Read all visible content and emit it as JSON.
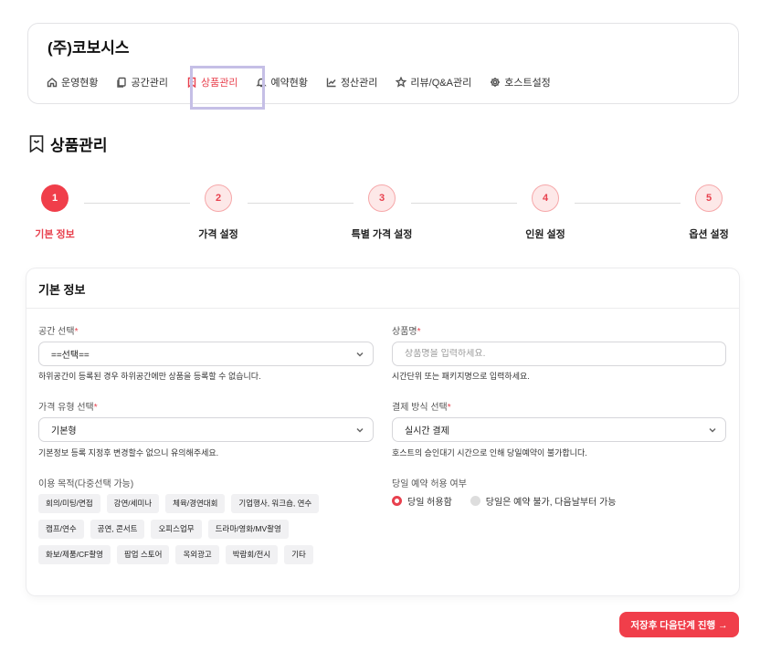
{
  "app": {
    "brand": "(주)코보시스"
  },
  "nav": {
    "items": [
      {
        "label": "운영현황",
        "icon": "home-icon"
      },
      {
        "label": "공간관리",
        "icon": "copy-icon"
      },
      {
        "label": "상품관리",
        "icon": "bookmark-icon",
        "active": true
      },
      {
        "label": "예약현황",
        "icon": "bell-icon"
      },
      {
        "label": "정산관리",
        "icon": "chart-icon"
      },
      {
        "label": "리뷰/Q&A관리",
        "icon": "star-icon"
      },
      {
        "label": "호스트설정",
        "icon": "gear-icon"
      }
    ]
  },
  "page": {
    "title": "상품관리",
    "icon": "bookmark-icon"
  },
  "stepper": {
    "steps": [
      {
        "num": "1",
        "label": "기본 정보",
        "active": true
      },
      {
        "num": "2",
        "label": "가격 설정"
      },
      {
        "num": "3",
        "label": "특별 가격 설정"
      },
      {
        "num": "4",
        "label": "인원 설정"
      },
      {
        "num": "5",
        "label": "옵션 설정"
      }
    ]
  },
  "form": {
    "title": "기본 정보",
    "space": {
      "label": "공간 선택",
      "value": "==선택==",
      "hint": "하위공간이 등록된 경우 하위공간에만 상품을 등록할 수 없습니다."
    },
    "product_name": {
      "label": "상품명",
      "placeholder": "상품명을 입력하세요.",
      "hint": "시간단위 또는 패키지명으로 입력하세요."
    },
    "price_type": {
      "label": "가격 유형 선택",
      "value": "기본형",
      "hint": "기본정보 등록 지정후 변경할수 없으니 유의해주세요."
    },
    "payment": {
      "label": "결제 방식 선택",
      "value": "실시간 결제",
      "hint": "호스트의 승인대기 시간으로 인해 당일예약이 불가합니다."
    },
    "purpose": {
      "label": "이용 목적(다중선택 가능)",
      "rows": [
        [
          "회의/미팅/면접",
          "강연/세미나",
          "체육/경연대회",
          "기업행사, 워크숍, 연수"
        ],
        [
          "캠프/연수",
          "공연, 콘서트",
          "오피스업무",
          "드라마/영화/MV촬영"
        ],
        [
          "화보/제품/CF촬영",
          "팝업 스토어",
          "옥외광고",
          "박람회/전시",
          "기타"
        ]
      ]
    },
    "same_day": {
      "label": "당일 예약 허용 여부",
      "options": [
        {
          "label": "당일 허용함",
          "selected": true
        },
        {
          "label": "당일은 예약 불가, 다음날부터 가능",
          "selected": false
        }
      ]
    },
    "required_mark": "*"
  },
  "actions": {
    "next_label": "저장후 다음단계 진행 →"
  },
  "colors": {
    "accent": "#f03e4a",
    "highlight_box": "#c5bfe6"
  }
}
